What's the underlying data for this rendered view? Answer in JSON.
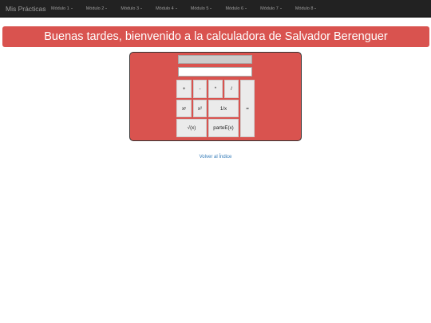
{
  "navbar": {
    "brand": "Mis Prácticas",
    "items": [
      {
        "label": "Módulo 1"
      },
      {
        "label": "Módulo 2"
      },
      {
        "label": "Módulo 3"
      },
      {
        "label": "Módulo 4"
      },
      {
        "label": "Módulo 5"
      },
      {
        "label": "Módulo 6"
      },
      {
        "label": "Módulo 7"
      },
      {
        "label": "Módulo 8"
      }
    ]
  },
  "banner": {
    "text": "Buenas tardes, bienvenido a la calculadora de Salvador Berenguer",
    "color": "#d9534f"
  },
  "calculator": {
    "display_value": "",
    "input_value": "",
    "keys": {
      "plus": "+",
      "minus": "-",
      "times": "*",
      "divide": "/",
      "power": "xʸ",
      "square": "x²",
      "reciprocal": "1/x",
      "equals": "=",
      "sqrt": "√(x)",
      "integer_part": "parteE(x)"
    }
  },
  "footer": {
    "back_link": "Volver al Índice"
  }
}
